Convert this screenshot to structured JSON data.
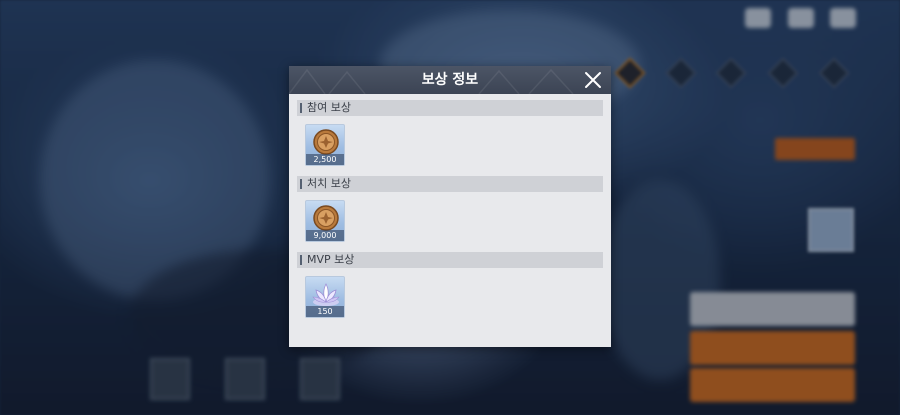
{
  "dialog": {
    "title": "보상 정보",
    "close_icon": "close-icon"
  },
  "sections": [
    {
      "title": "참여 보상",
      "rewards": [
        {
          "icon": "gold-coin-icon",
          "count": "2,500"
        }
      ]
    },
    {
      "title": "처치 보상",
      "rewards": [
        {
          "icon": "gold-coin-icon",
          "count": "9,000"
        }
      ]
    },
    {
      "title": "MVP 보상",
      "rewards": [
        {
          "icon": "lotus-crystal-icon",
          "count": "150"
        }
      ]
    }
  ],
  "colors": {
    "header_bg": "#454e5e",
    "dialog_bg": "#e8e9ec",
    "section_bg": "#cfd1d6",
    "slot_bg": "#a9c4e6",
    "hud_orange": "#d86f1e"
  }
}
